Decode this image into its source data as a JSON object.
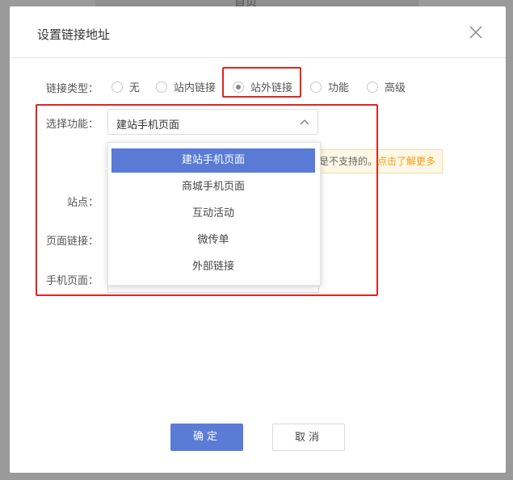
{
  "background": {
    "partial_title": "首页"
  },
  "dialog": {
    "title": "设置链接地址"
  },
  "link_type": {
    "label": "链接类型：",
    "options": [
      {
        "label": "无",
        "checked": false
      },
      {
        "label": "站内链接",
        "checked": false
      },
      {
        "label": "站外链接",
        "checked": true
      },
      {
        "label": "功能",
        "checked": false
      },
      {
        "label": "高级",
        "checked": false
      }
    ]
  },
  "function_select": {
    "label": "选择功能：",
    "value": "建站手机页面",
    "expanded": true,
    "options": [
      {
        "label": "建站手机页面",
        "selected": true
      },
      {
        "label": "商城手机页面",
        "selected": false
      },
      {
        "label": "互动活动",
        "selected": false
      },
      {
        "label": "微传单",
        "selected": false
      },
      {
        "label": "外部链接",
        "selected": false
      }
    ]
  },
  "tip": {
    "text": "是不支持的。",
    "link": "点击了解更多"
  },
  "fields": {
    "site_label": "站点：",
    "page_link_label": "页面链接：",
    "mobile_page_label": "手机页面："
  },
  "footer": {
    "ok_label": "确定",
    "cancel_label": "取消"
  },
  "colors": {
    "primary": "#5a7bd6",
    "highlight": "#e02424",
    "link": "#f39c12",
    "tip_bg": "#fff8e6"
  }
}
